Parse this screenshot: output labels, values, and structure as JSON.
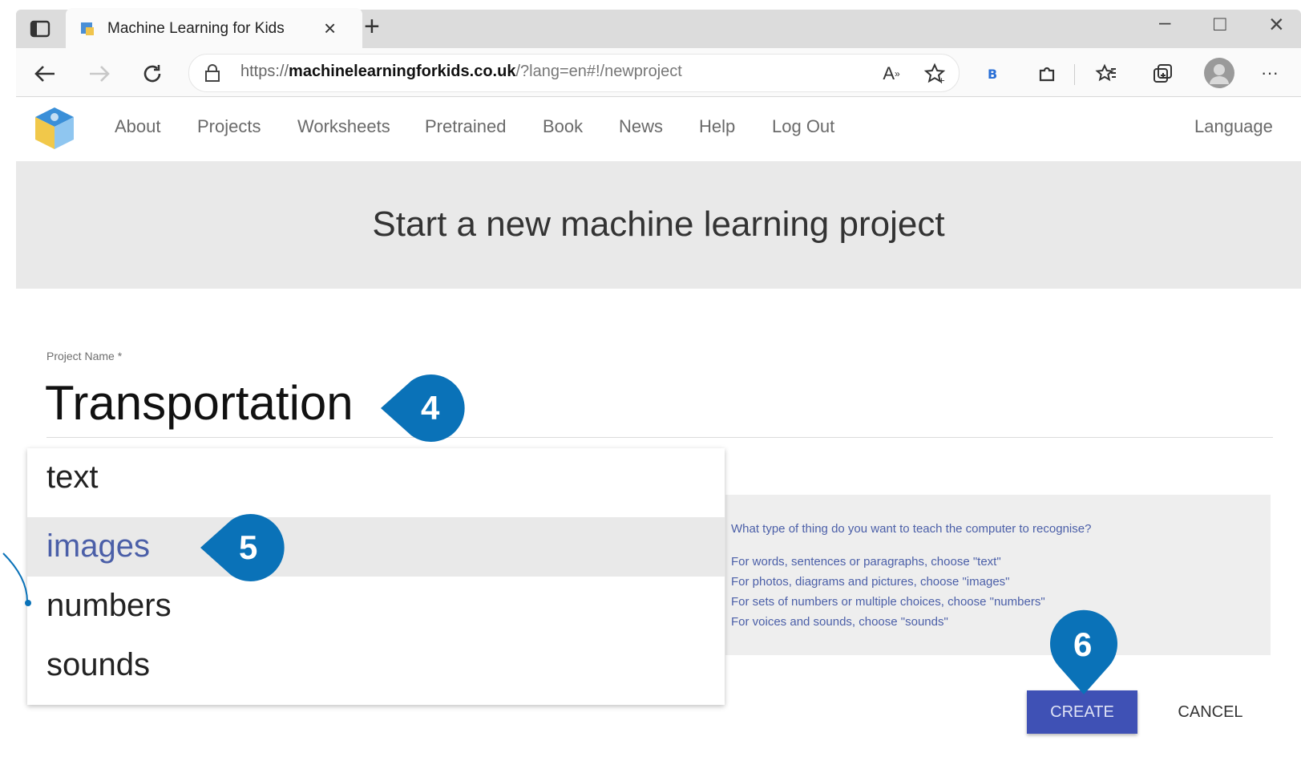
{
  "browser": {
    "tab_title": "Machine Learning for Kids",
    "tab_close": "×",
    "new_tab": "+",
    "url_prefix": "https://",
    "url_domain": "machinelearningforkids.co.uk",
    "url_path": "/?lang=en#!/newproject",
    "window_minimize": "–",
    "window_maximize": "□",
    "window_close": "×",
    "more_menu": "···"
  },
  "nav": {
    "items": [
      "About",
      "Projects",
      "Worksheets",
      "Pretrained",
      "Book",
      "News",
      "Help",
      "Log Out"
    ],
    "language": "Language"
  },
  "banner": {
    "title": "Start a new machine learning project"
  },
  "form": {
    "project_name_label": "Project Name *",
    "project_name_value": "Transportation"
  },
  "dropdown": {
    "options": [
      "text",
      "images",
      "numbers",
      "sounds"
    ],
    "selected": "images"
  },
  "help": {
    "question": "What type of thing do you want to teach the computer to recognise?",
    "lines": [
      "For words, sentences or paragraphs, choose \"text\"",
      "For photos, diagrams and pictures, choose \"images\"",
      "For sets of numbers or multiple choices, choose \"numbers\"",
      "For voices and sounds, choose \"sounds\""
    ]
  },
  "buttons": {
    "create": "CREATE",
    "cancel": "CANCEL"
  },
  "callouts": {
    "step4": "4",
    "step5": "5",
    "step6": "6"
  },
  "colors": {
    "callout_blue": "#0a72b8",
    "accent": "#3f51b5",
    "selected_text": "#4b5fa8"
  }
}
